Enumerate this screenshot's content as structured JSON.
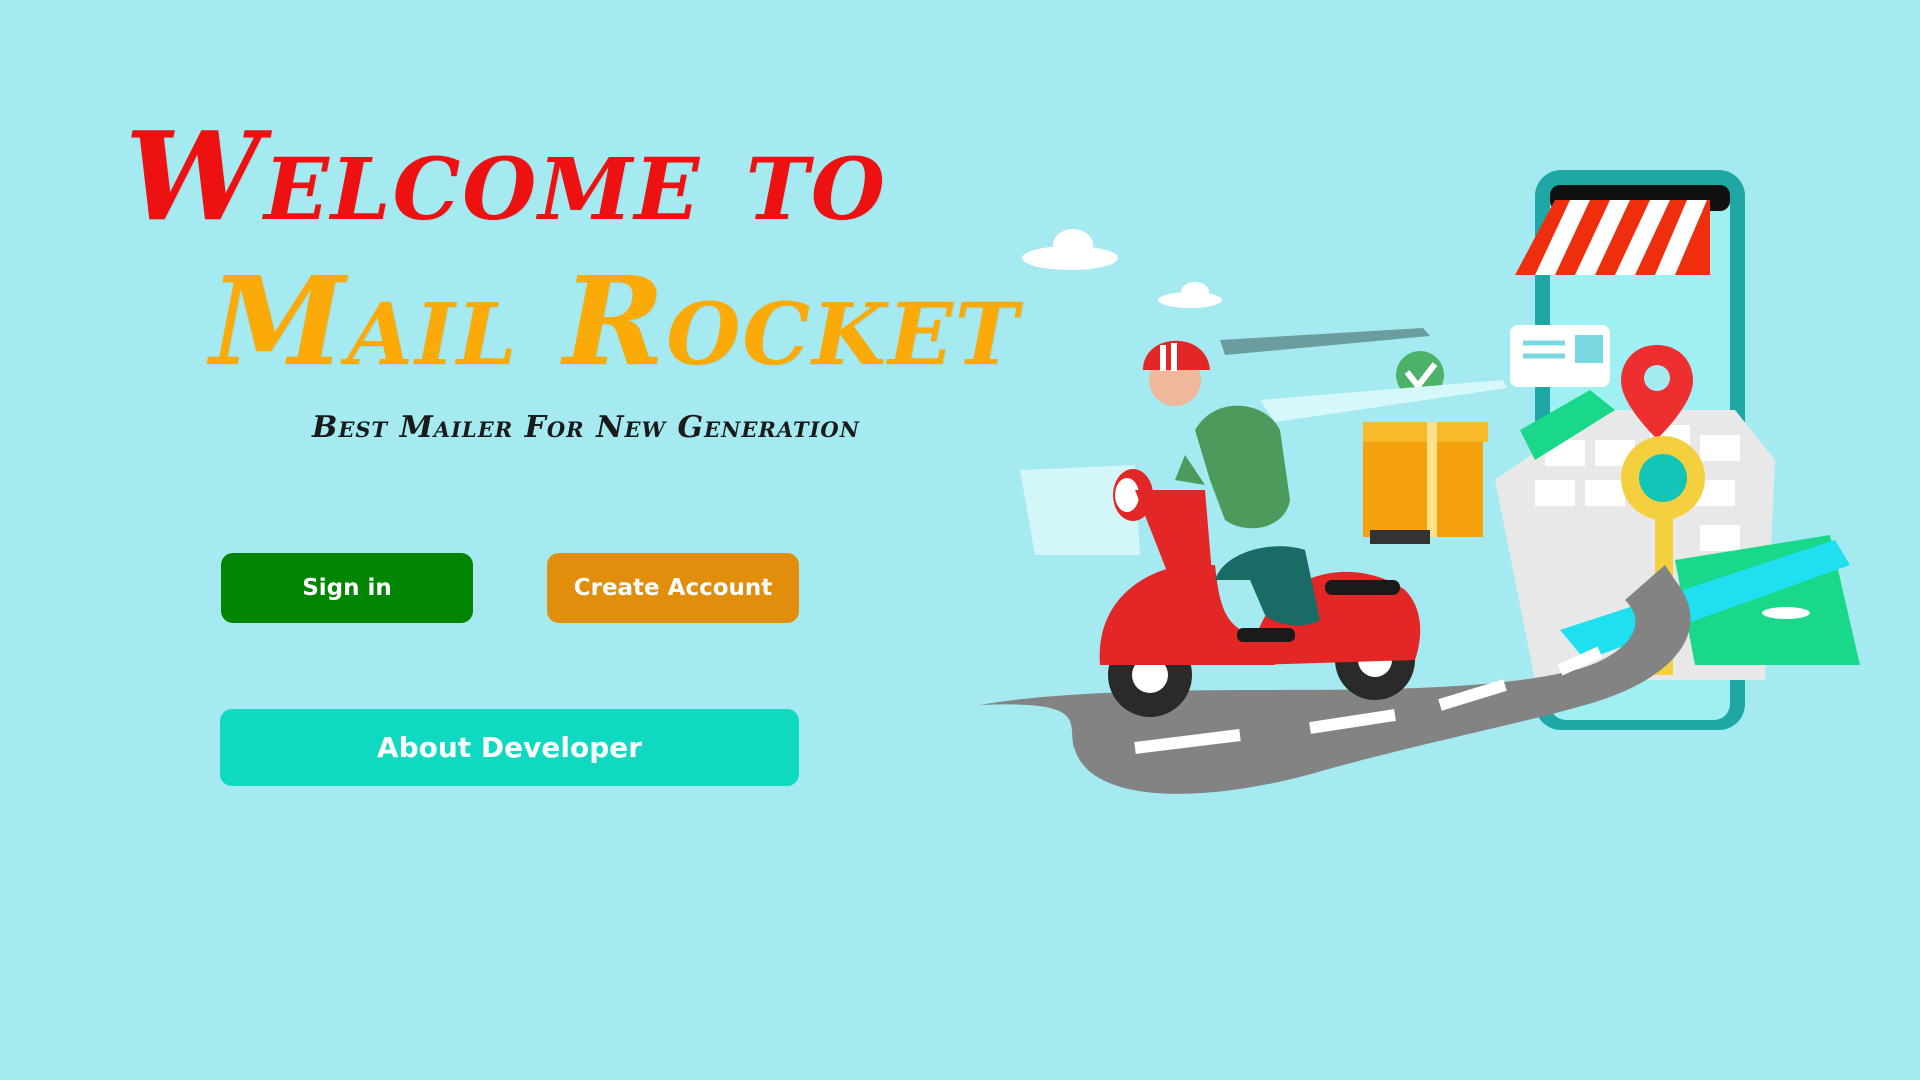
{
  "hero": {
    "title_line1": "Welcome to",
    "title_line2": "Mail Rocket",
    "tagline": "Best Mailer For New Generation"
  },
  "buttons": {
    "sign_in": "Sign in",
    "create_account": "Create Account",
    "about_developer": "About Developer"
  },
  "colors": {
    "background": "#a5eaf1",
    "title_line1": "#ee1111",
    "title_line2": "#fbaa07",
    "sign_in": "#028502",
    "create_account": "#e08e0b",
    "about_developer": "#0fd9c0"
  },
  "illustration": {
    "subject": "delivery-scooter-illustration"
  }
}
